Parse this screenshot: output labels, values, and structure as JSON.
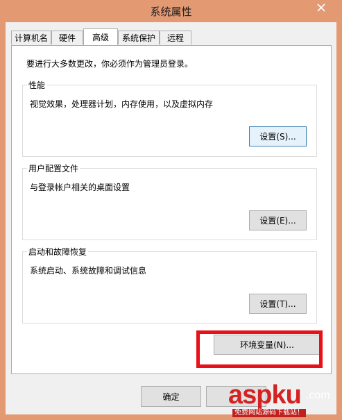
{
  "window": {
    "title": "系统属性"
  },
  "tabs": [
    {
      "label": "计算机名"
    },
    {
      "label": "硬件"
    },
    {
      "label": "高级",
      "active": true
    },
    {
      "label": "系统保护"
    },
    {
      "label": "远程"
    }
  ],
  "admin_notice": "要进行大多数更改，你必须作为管理员登录。",
  "groups": {
    "performance": {
      "title": "性能",
      "description": "视觉效果，处理器计划，内存使用，以及虚拟内存",
      "button": "设置(S)..."
    },
    "user_profiles": {
      "title": "用户配置文件",
      "description": "与登录帐户相关的桌面设置",
      "button": "设置(E)..."
    },
    "startup_recovery": {
      "title": "启动和故障恢复",
      "description": "系统启动、系统故障和调试信息",
      "button": "设置(T)..."
    }
  },
  "env_button": "环境变量(N)...",
  "footer": {
    "ok": "确定"
  },
  "watermark": {
    "brand": "aspku",
    "domain": ".com",
    "tagline": "免费网站源码下载站！"
  },
  "colors": {
    "frame": "#e39a73",
    "highlight": "#e8111a",
    "watermark": "#d42222"
  },
  "icons": {
    "close": "close-icon"
  }
}
